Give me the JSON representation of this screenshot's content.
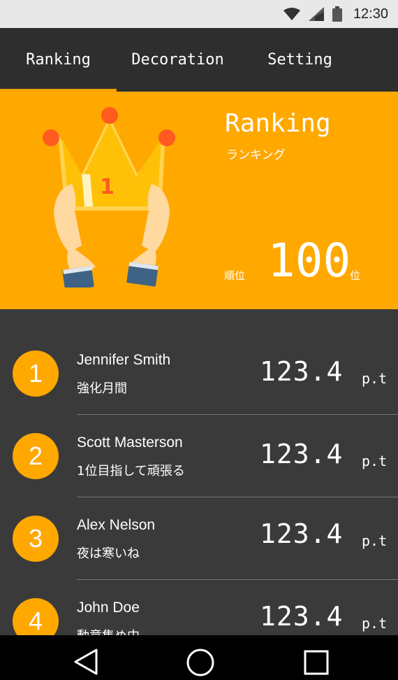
{
  "status": {
    "time": "12:30",
    "icons": [
      "wifi-icon",
      "signal-icon",
      "battery-icon"
    ]
  },
  "tabs": [
    {
      "label": "Ranking",
      "active": true
    },
    {
      "label": "Decoration",
      "active": false
    },
    {
      "label": "Setting",
      "active": false
    }
  ],
  "hero": {
    "title": "Ranking",
    "subtitle": "ランキング",
    "rank_label": "順位",
    "rank_value": "100",
    "rank_unit": "位",
    "crown_number": "1"
  },
  "ranking": [
    {
      "rank": "1",
      "name": "Jennifer Smith",
      "comment": "強化月間",
      "score": "123.4",
      "unit": "p.t"
    },
    {
      "rank": "2",
      "name": "Scott Masterson",
      "comment": "1位目指して頑張る",
      "score": "123.4",
      "unit": "p.t"
    },
    {
      "rank": "3",
      "name": "Alex Nelson",
      "comment": "夜は寒いね",
      "score": "123.4",
      "unit": "p.t"
    },
    {
      "rank": "4",
      "name": "John Doe",
      "comment": "動意集め中",
      "score": "123.4",
      "unit": "p.t"
    }
  ],
  "colors": {
    "accent": "#ffa800",
    "tabbar": "#2e2e2e",
    "list_bg": "#3a3a3a"
  },
  "navbar": {
    "icons": [
      "back-icon",
      "home-icon",
      "recents-icon"
    ]
  }
}
